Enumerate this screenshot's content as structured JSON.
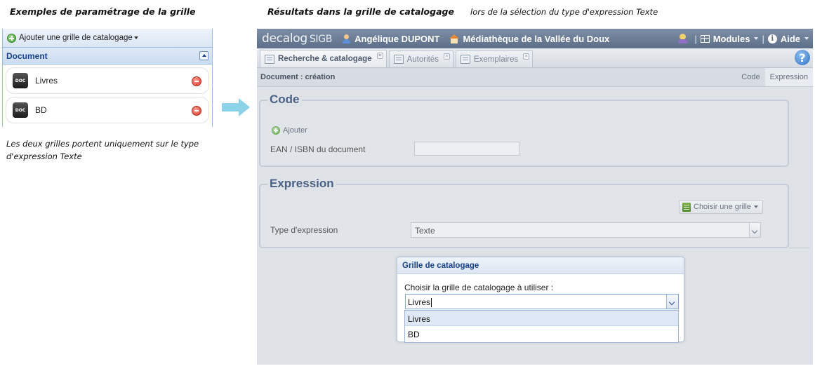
{
  "captions": {
    "left_title": "Exemples de paramétrage de la grille",
    "right_title": "Résultats dans la grille de catalogage",
    "right_subtitle": "lors de la sélection du type d'expression Texte",
    "left_note": "Les deux grilles portent uniquement sur le type d'expression Texte"
  },
  "left_panel": {
    "toolbar_label": "Ajouter une grille de catalogage",
    "section_title": "Document",
    "items": [
      {
        "icon": "doc-icon",
        "icon_text": "DOC",
        "label": "Livres"
      },
      {
        "icon": "doc-icon",
        "icon_text": "DOC",
        "label": "BD"
      }
    ]
  },
  "app": {
    "logo": "decalog",
    "logo_suffix": "SIGB",
    "user": "Angélique DUPONT",
    "library": "Médiathèque de la Vallée du Doux",
    "modules_label": "Modules",
    "help_label": "Aide",
    "tabs": [
      {
        "label": "Recherche & catalogage",
        "active": true
      },
      {
        "label": "Autorités",
        "active": false
      },
      {
        "label": "Exemplaires",
        "active": false
      }
    ],
    "breadcrumb": "Document : création",
    "view_tabs": [
      {
        "label": "Code",
        "active": false
      },
      {
        "label": "Expression",
        "active": true
      }
    ],
    "code_section": {
      "legend": "Code",
      "add_label": "Ajouter",
      "field_label": "EAN / ISBN du document",
      "field_value": ""
    },
    "expression_section": {
      "legend": "Expression",
      "choose_grid_label": "Choisir une grille",
      "field_label": "Type d'expression",
      "field_value": "Texte"
    },
    "dialog": {
      "title": "Grille de catalogage",
      "prompt": "Choisir la grille de catalogage à utiliser :",
      "selected_value": "Livres",
      "options": [
        "Livres",
        "BD"
      ]
    }
  },
  "colors": {
    "topbar": "#6a7b93",
    "legend_text": "#4a6184",
    "panel_header_text": "#15428b",
    "arrow": "#8cd3ea"
  }
}
